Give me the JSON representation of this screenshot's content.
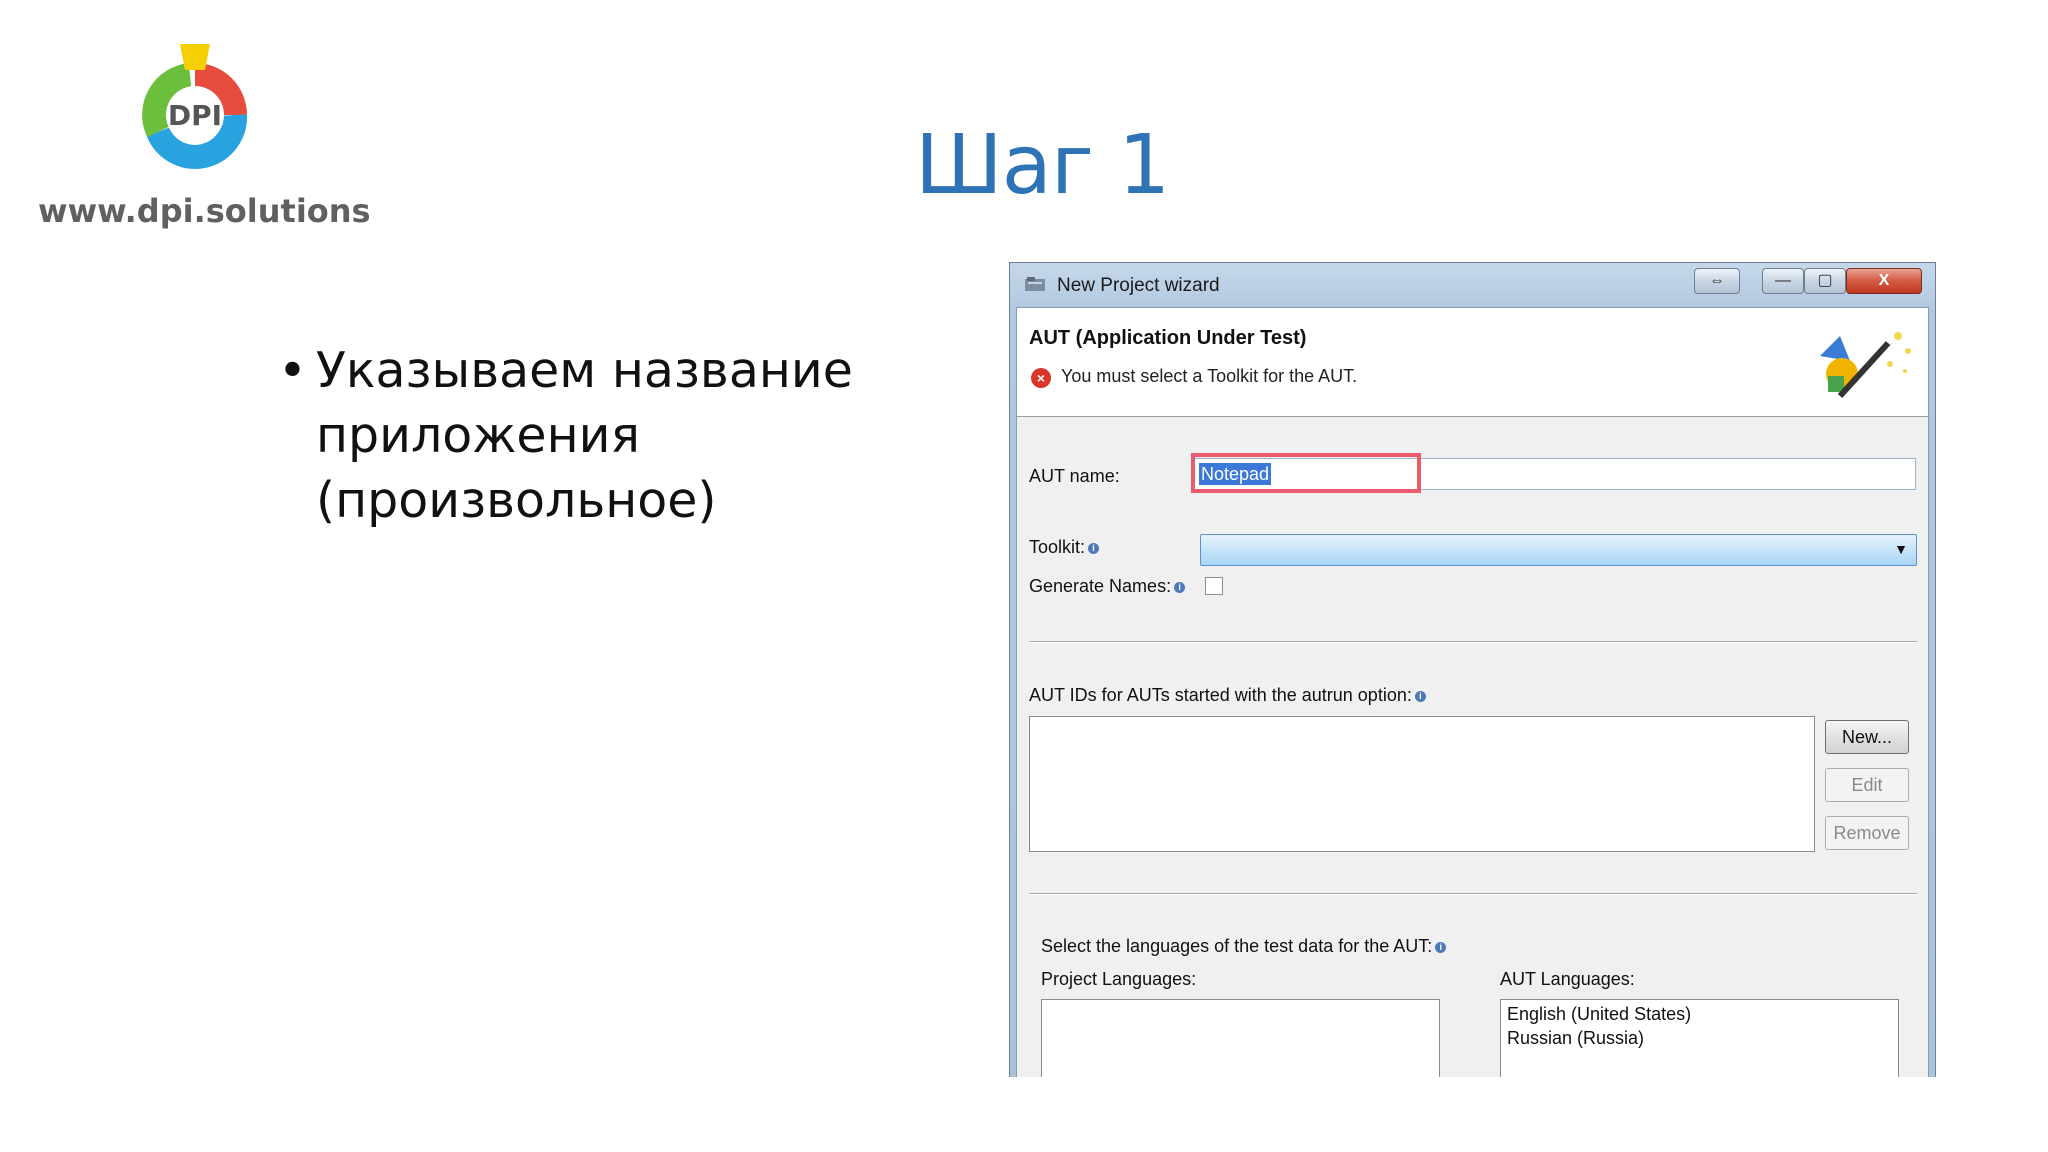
{
  "logo": {
    "text": "DPI",
    "url": "www.dpi.solutions"
  },
  "slide": {
    "title": "Шаг 1",
    "bullet": "Указываем название приложения (произвольное)"
  },
  "dialog": {
    "title": "New Project wizard",
    "controls": {
      "restore": "⇔",
      "minimize": "—",
      "maximize": "▢",
      "close": "X"
    },
    "banner_title": "AUT (Application Under Test)",
    "banner_message": "You must select a Toolkit for the AUT.",
    "aut_name_label": "AUT name:",
    "aut_name_value": "Notepad",
    "toolkit_label": "Toolkit:",
    "generate_names_label": "Generate Names:",
    "aut_ids_label": "AUT IDs for AUTs started with the autrun option:",
    "buttons": {
      "new": "New...",
      "edit": "Edit",
      "remove": "Remove"
    },
    "languages_label": "Select the languages of the test data for the AUT:",
    "project_languages_label": "Project Languages:",
    "aut_languages_label": "AUT Languages:",
    "aut_languages": [
      "English (United States)",
      "Russian (Russia)"
    ]
  },
  "colors": {
    "title": "#2e73b5",
    "highlight": "#ea5b6d",
    "selection": "#3b78d8"
  }
}
